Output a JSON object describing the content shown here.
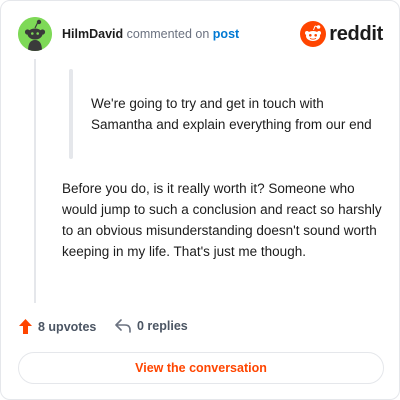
{
  "header": {
    "username": "HilmDavid",
    "commented": "commented on",
    "post_link": "post",
    "logo_text": "reddit"
  },
  "quote": {
    "text": "We're going to try and get in touch with Samantha and explain everything from our end"
  },
  "comment": {
    "text": "Before you do, is it really worth it? Someone who would jump to such a conclusion and react so harshly to an obvious misunderstanding doesn't sound worth keeping in my life. That's just me though."
  },
  "footer": {
    "upvotes": "8 upvotes",
    "replies": "0 replies",
    "view_button": "View the conversation"
  },
  "colors": {
    "brand": "#ff4500",
    "link": "#0079d3",
    "avatar_bg": "#7ed957"
  },
  "icons": {
    "avatar": "snoo-avatar-icon",
    "logo": "reddit-logo-icon",
    "upvote": "upvote-arrow-icon",
    "reply": "reply-arrow-icon"
  }
}
